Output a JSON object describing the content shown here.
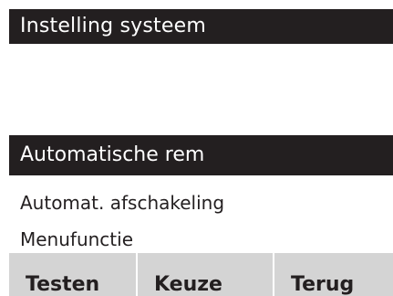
{
  "screen": {
    "title": "Instelling systeem",
    "selected_item": "Automatische rem",
    "items": [
      "Automat. afschakeling",
      "Menufunctie"
    ],
    "softkeys": [
      "Testen",
      "Keuze",
      "Terug"
    ]
  },
  "colors": {
    "bar_background": "#231f20",
    "bar_text": "#ffffff",
    "softkey_background": "#d4d4d4",
    "text": "#231f20"
  }
}
